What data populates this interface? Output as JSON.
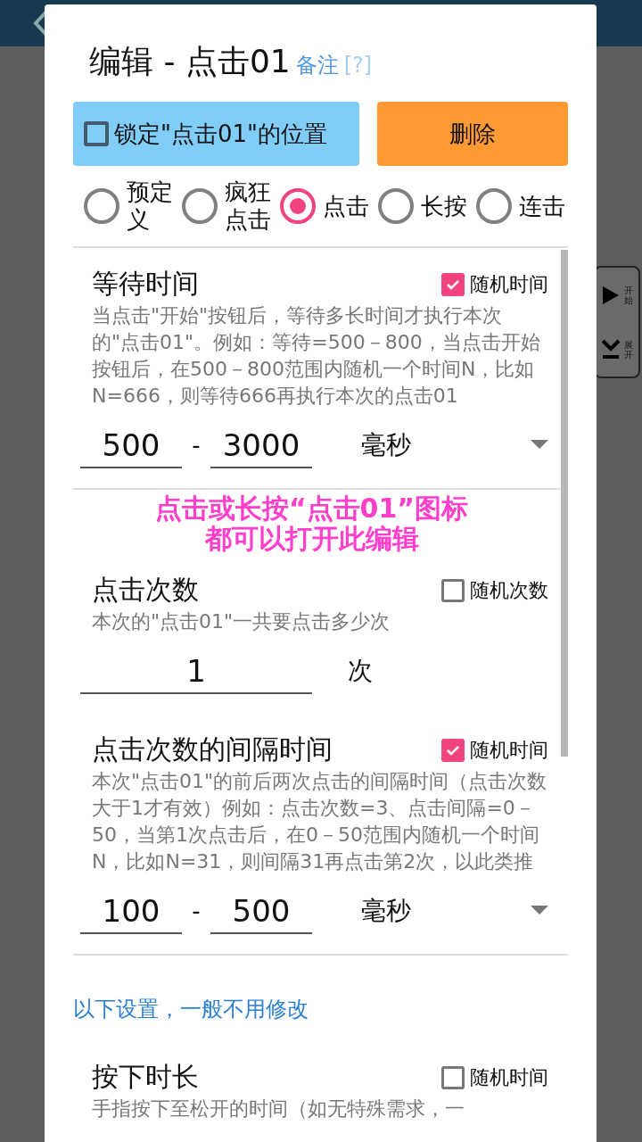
{
  "dialog": {
    "title": "编辑 - 点击01",
    "note_link": "备注",
    "help": "[?]"
  },
  "lock_button": {
    "label": "锁定\"点击01\"的位置",
    "checked": false
  },
  "delete_button": "删除",
  "modes": [
    {
      "label": "预定义",
      "selected": false
    },
    {
      "label": "疯狂点击",
      "selected": false
    },
    {
      "label": "点击",
      "selected": true
    },
    {
      "label": "长按",
      "selected": false
    },
    {
      "label": "连击",
      "selected": false
    }
  ],
  "sections": [
    {
      "kind": "range",
      "title": "等待时间",
      "random": {
        "label": "随机时间",
        "checked": true
      },
      "description": "当点击\"开始\"按钮后，等待多长时间才执行本次的\"点击01\"。例如：等待=500－800，当点击开始按钮后，在500－800范围内随机一个时间N，比如N=666，则等待666再执行本次的点击01",
      "from": "500",
      "separator": "-",
      "to": "3000",
      "unit": "毫秒"
    },
    {
      "kind": "single",
      "title": "点击次数",
      "random": {
        "label": "随机次数",
        "checked": false
      },
      "description": "本次的\"点击01\"一共要点击多少次",
      "value": "1",
      "unit": "次"
    },
    {
      "kind": "range",
      "title": "点击次数的间隔时间",
      "random": {
        "label": "随机时间",
        "checked": true
      },
      "description": "本次\"点击01\"的前后两次点击的间隔时间（点击次数大于1才有效）例如：点击次数=3、点击间隔=0－50，当第1次点击后，在0－50范围内随机一个时间N，比如N=31，则间隔31再点击第2次，以此类推",
      "from": "100",
      "separator": "-",
      "to": "500",
      "unit": "毫秒"
    }
  ],
  "advanced_note": "以下设置，一般不用修改",
  "advanced_sections": [
    {
      "title": "按下时长",
      "random": {
        "label": "随机时间",
        "checked": false
      },
      "description": "手指按下至松开的时间（如无特殊需求，一"
    }
  ],
  "overlay_hint": [
    "点击或长按“点击01”图标",
    "都可以打开此编辑"
  ],
  "floating_widget": [
    {
      "kind": "play",
      "label": "开始"
    },
    {
      "kind": "expand",
      "label": "展开"
    }
  ]
}
